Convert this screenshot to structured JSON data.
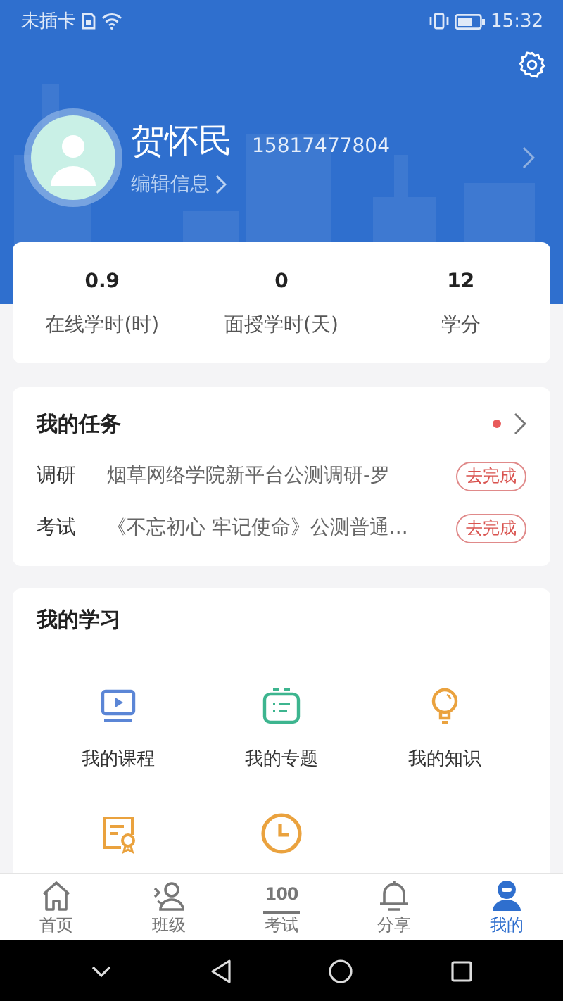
{
  "status_bar": {
    "carrier": "未插卡",
    "time": "15:32"
  },
  "profile": {
    "name": "贺怀民",
    "phone": "15817477804",
    "edit_link": "编辑信息"
  },
  "stats": [
    {
      "value": "0.9",
      "label": "在线学时(时)"
    },
    {
      "value": "0",
      "label": "面授学时(天)"
    },
    {
      "value": "12",
      "label": "学分"
    }
  ],
  "tasks": {
    "title": "我的任务",
    "has_new": true,
    "items": [
      {
        "type": "调研",
        "title": "烟草网络学院新平台公测调研-罗",
        "action": "去完成"
      },
      {
        "type": "考试",
        "title": "《不忘初心 牢记使命》公测普通...",
        "action": "去完成"
      }
    ]
  },
  "learning": {
    "title": "我的学习",
    "items": [
      {
        "kind": "labeled",
        "label": "我的课程"
      },
      {
        "kind": "labeled",
        "label": "我的专题"
      },
      {
        "kind": "labeled",
        "label": "我的知识"
      },
      {
        "kind": "icon_only"
      },
      {
        "kind": "icon_only"
      }
    ]
  },
  "tab_bar": [
    {
      "label": "首页",
      "selected": false
    },
    {
      "label": "班级",
      "selected": false
    },
    {
      "icon_text": "100",
      "label": "考试",
      "selected": false
    },
    {
      "label": "分享",
      "selected": false
    },
    {
      "label": "我的",
      "selected": true
    }
  ]
}
